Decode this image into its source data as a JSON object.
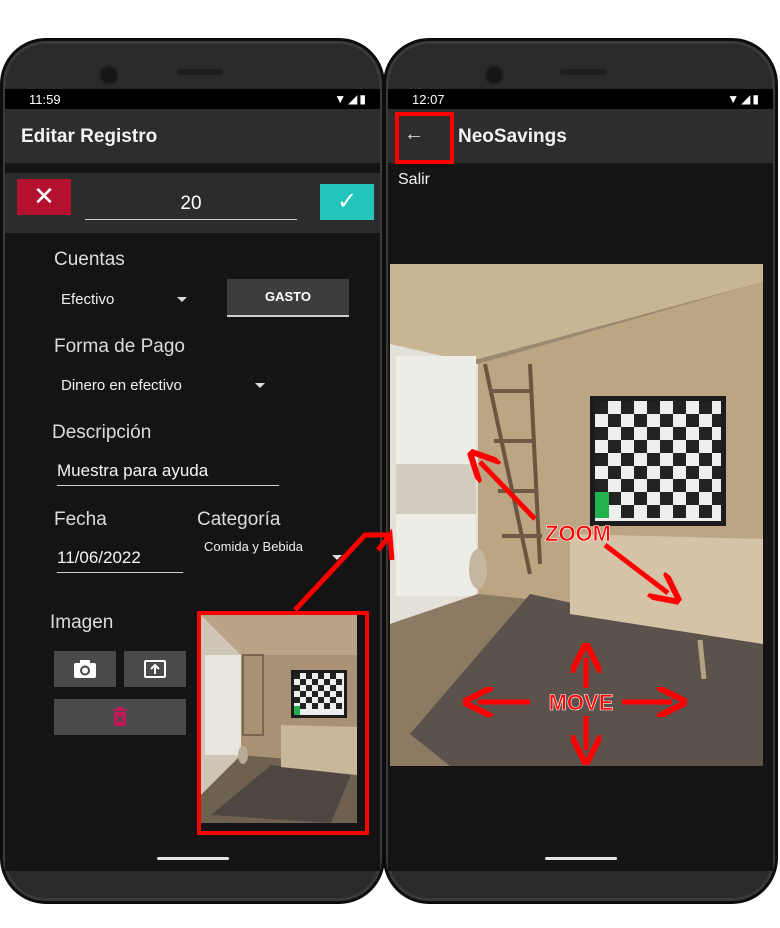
{
  "left_phone": {
    "status": {
      "time": "11:59",
      "icons": "▼◢▮"
    },
    "appbar": {
      "title": "Editar Registro"
    },
    "amount": {
      "value": "20",
      "cancel_icon": "✕",
      "confirm_icon": "✓"
    },
    "cuentas": {
      "label": "Cuentas",
      "selected": "Efectivo",
      "type_button": "GASTO"
    },
    "forma_pago": {
      "label": "Forma de Pago",
      "selected": "Dinero en efectivo"
    },
    "descripcion": {
      "label": "Descripción",
      "value": "Muestra para ayuda"
    },
    "fecha": {
      "label": "Fecha",
      "value": "11/06/2022"
    },
    "categoria": {
      "label": "Categoría",
      "selected": "Comida y Bebida"
    },
    "imagen": {
      "label": "Imagen",
      "icons": [
        "camera-icon",
        "upload-icon",
        "delete-icon"
      ]
    }
  },
  "right_phone": {
    "status": {
      "time": "12:07",
      "icons": "▼◢▮"
    },
    "appbar": {
      "title": "NeoSavings",
      "back_icon": "←"
    },
    "exit_label": "Salir",
    "annotations": {
      "zoom": "ZOOM",
      "move": "MOVE"
    }
  },
  "colors": {
    "accent_teal": "#23c5bb",
    "cancel_red": "#b3112e",
    "annotation_red": "#ff0000"
  }
}
